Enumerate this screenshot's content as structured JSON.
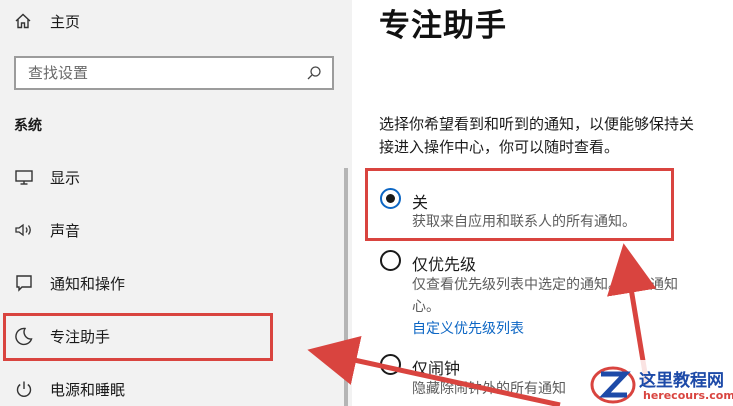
{
  "sidebar": {
    "home_label": "主页",
    "search": {
      "placeholder": "查找设置"
    },
    "section_title": "系统",
    "items": [
      {
        "label": "显示",
        "icon": "monitor-icon"
      },
      {
        "label": "声音",
        "icon": "speaker-icon"
      },
      {
        "label": "通知和操作",
        "icon": "message-icon"
      },
      {
        "label": "专注助手",
        "icon": "moon-icon",
        "highlighted": true
      },
      {
        "label": "电源和睡眠",
        "icon": "power-icon"
      }
    ]
  },
  "main": {
    "title": "专注助手",
    "description_lines": [
      "选择你希望看到和听到的通知，以便能够保持关",
      "接进入操作中心，你可以随时查看。"
    ],
    "options": [
      {
        "label": "关",
        "description": "获取来自应用和联系人的所有通知。",
        "selected": true
      },
      {
        "label": "仅优先级",
        "description_lines": [
          "仅查看优先级列表中选定的通知。其余通知",
          "心。"
        ],
        "link": "自定义优先级列表",
        "selected": false
      },
      {
        "label": "仅闹钟",
        "description": "隐藏除闹钟外的所有通知",
        "selected": false
      }
    ]
  },
  "annotation": {
    "color": "#d9443f"
  },
  "watermark": {
    "title": "这里教程网",
    "url": "herecours.com"
  }
}
